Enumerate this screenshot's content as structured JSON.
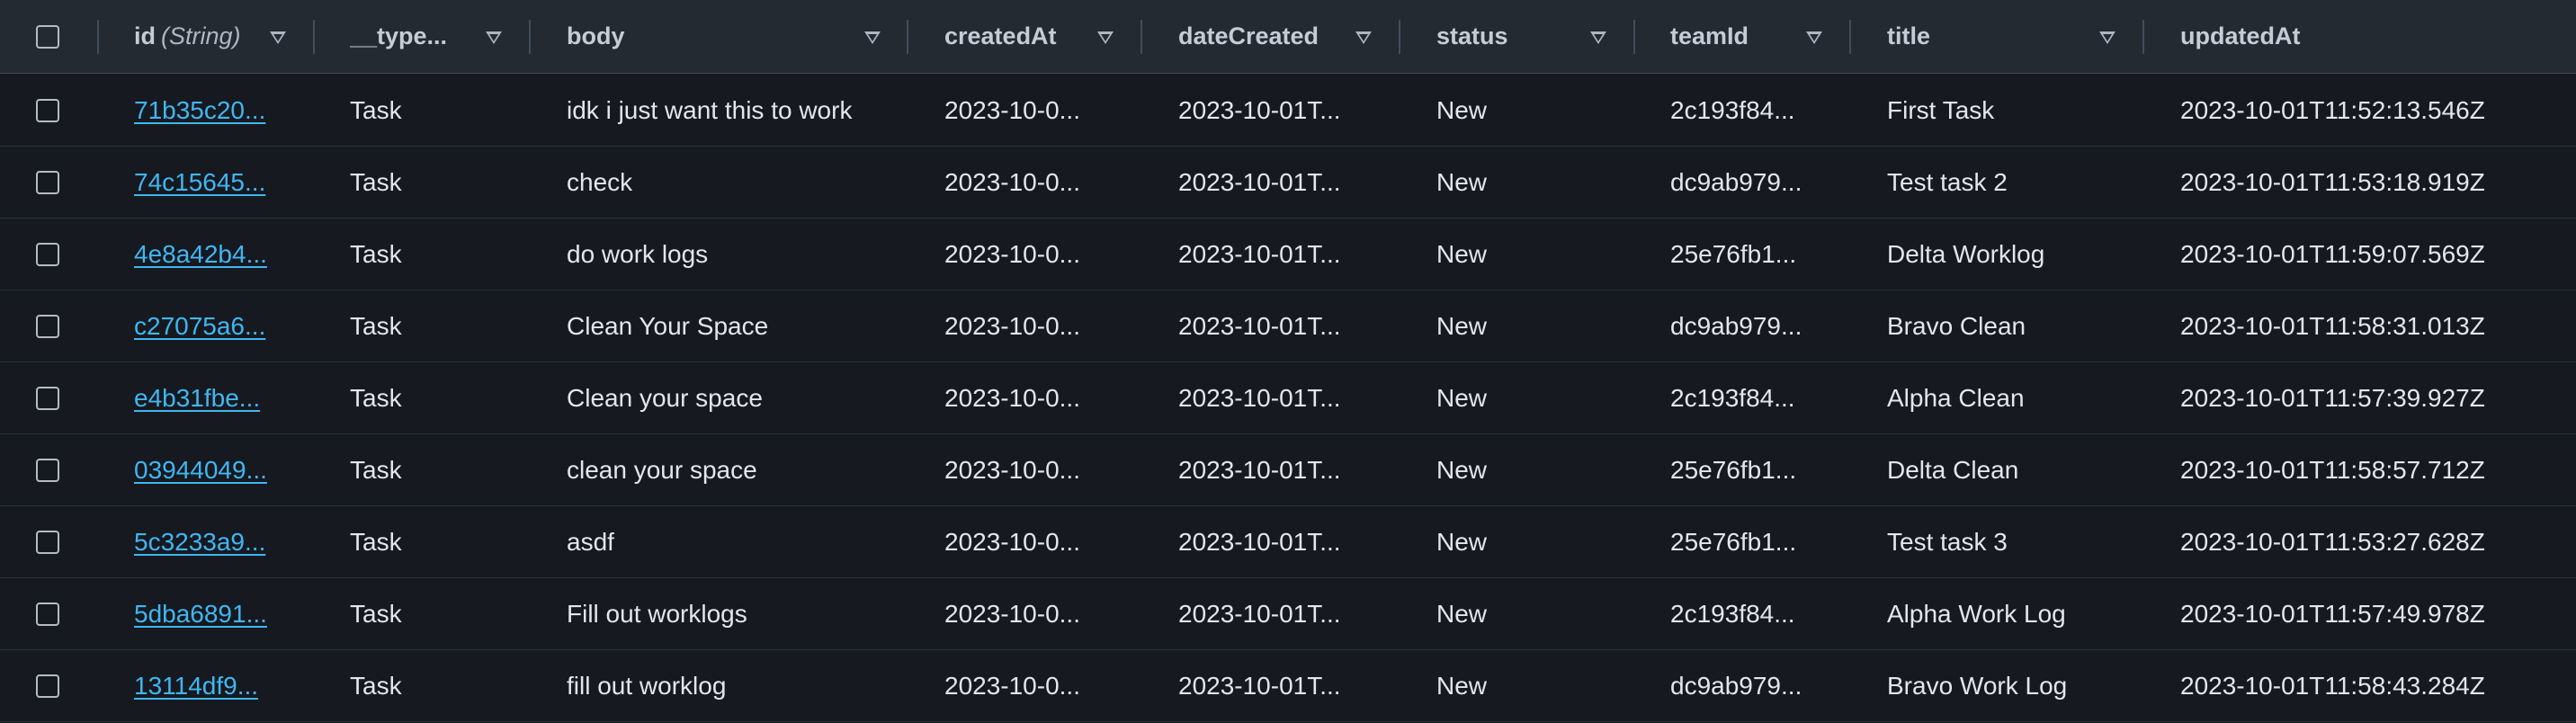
{
  "columns": [
    {
      "key": "id",
      "label": "id",
      "type_hint": "(String)"
    },
    {
      "key": "type",
      "label": "__type..."
    },
    {
      "key": "body",
      "label": "body"
    },
    {
      "key": "createdAt",
      "label": "createdAt"
    },
    {
      "key": "dateCreated",
      "label": "dateCreated"
    },
    {
      "key": "status",
      "label": "status"
    },
    {
      "key": "teamId",
      "label": "teamId"
    },
    {
      "key": "title",
      "label": "title"
    },
    {
      "key": "updatedAt",
      "label": "updatedAt"
    }
  ],
  "rows": [
    {
      "id": "71b35c20...",
      "type": "Task",
      "body": "idk i just want this to work",
      "createdAt": "2023-10-0...",
      "dateCreated": "2023-10-01T...",
      "status": "New",
      "teamId": "2c193f84...",
      "title": "First Task",
      "updatedAt": "2023-10-01T11:52:13.546Z"
    },
    {
      "id": "74c15645...",
      "type": "Task",
      "body": "check",
      "createdAt": "2023-10-0...",
      "dateCreated": "2023-10-01T...",
      "status": "New",
      "teamId": "dc9ab979...",
      "title": "Test task 2",
      "updatedAt": "2023-10-01T11:53:18.919Z"
    },
    {
      "id": "4e8a42b4...",
      "type": "Task",
      "body": "do work logs",
      "createdAt": "2023-10-0...",
      "dateCreated": "2023-10-01T...",
      "status": "New",
      "teamId": "25e76fb1...",
      "title": "Delta Worklog",
      "updatedAt": "2023-10-01T11:59:07.569Z"
    },
    {
      "id": "c27075a6...",
      "type": "Task",
      "body": "Clean Your Space",
      "createdAt": "2023-10-0...",
      "dateCreated": "2023-10-01T...",
      "status": "New",
      "teamId": "dc9ab979...",
      "title": "Bravo Clean",
      "updatedAt": "2023-10-01T11:58:31.013Z"
    },
    {
      "id": "e4b31fbe...",
      "type": "Task",
      "body": "Clean your space",
      "createdAt": "2023-10-0...",
      "dateCreated": "2023-10-01T...",
      "status": "New",
      "teamId": "2c193f84...",
      "title": "Alpha Clean",
      "updatedAt": "2023-10-01T11:57:39.927Z"
    },
    {
      "id": "03944049...",
      "type": "Task",
      "body": "clean your space",
      "createdAt": "2023-10-0...",
      "dateCreated": "2023-10-01T...",
      "status": "New",
      "teamId": "25e76fb1...",
      "title": "Delta Clean",
      "updatedAt": "2023-10-01T11:58:57.712Z"
    },
    {
      "id": "5c3233a9...",
      "type": "Task",
      "body": "asdf",
      "createdAt": "2023-10-0...",
      "dateCreated": "2023-10-01T...",
      "status": "New",
      "teamId": "25e76fb1...",
      "title": "Test task 3",
      "updatedAt": "2023-10-01T11:53:27.628Z"
    },
    {
      "id": "5dba6891...",
      "type": "Task",
      "body": "Fill out worklogs",
      "createdAt": "2023-10-0...",
      "dateCreated": "2023-10-01T...",
      "status": "New",
      "teamId": "2c193f84...",
      "title": "Alpha Work Log",
      "updatedAt": "2023-10-01T11:57:49.978Z"
    },
    {
      "id": "13114df9...",
      "type": "Task",
      "body": "fill out worklog",
      "createdAt": "2023-10-0...",
      "dateCreated": "2023-10-01T...",
      "status": "New",
      "teamId": "dc9ab979...",
      "title": "Bravo Work Log",
      "updatedAt": "2023-10-01T11:58:43.284Z"
    }
  ],
  "icons": {
    "sort": "caret-down-icon",
    "select": "checkbox-icon"
  },
  "colors": {
    "link": "#40b6f2",
    "header_bg": "#232a32",
    "row_bg": "#16191f"
  }
}
